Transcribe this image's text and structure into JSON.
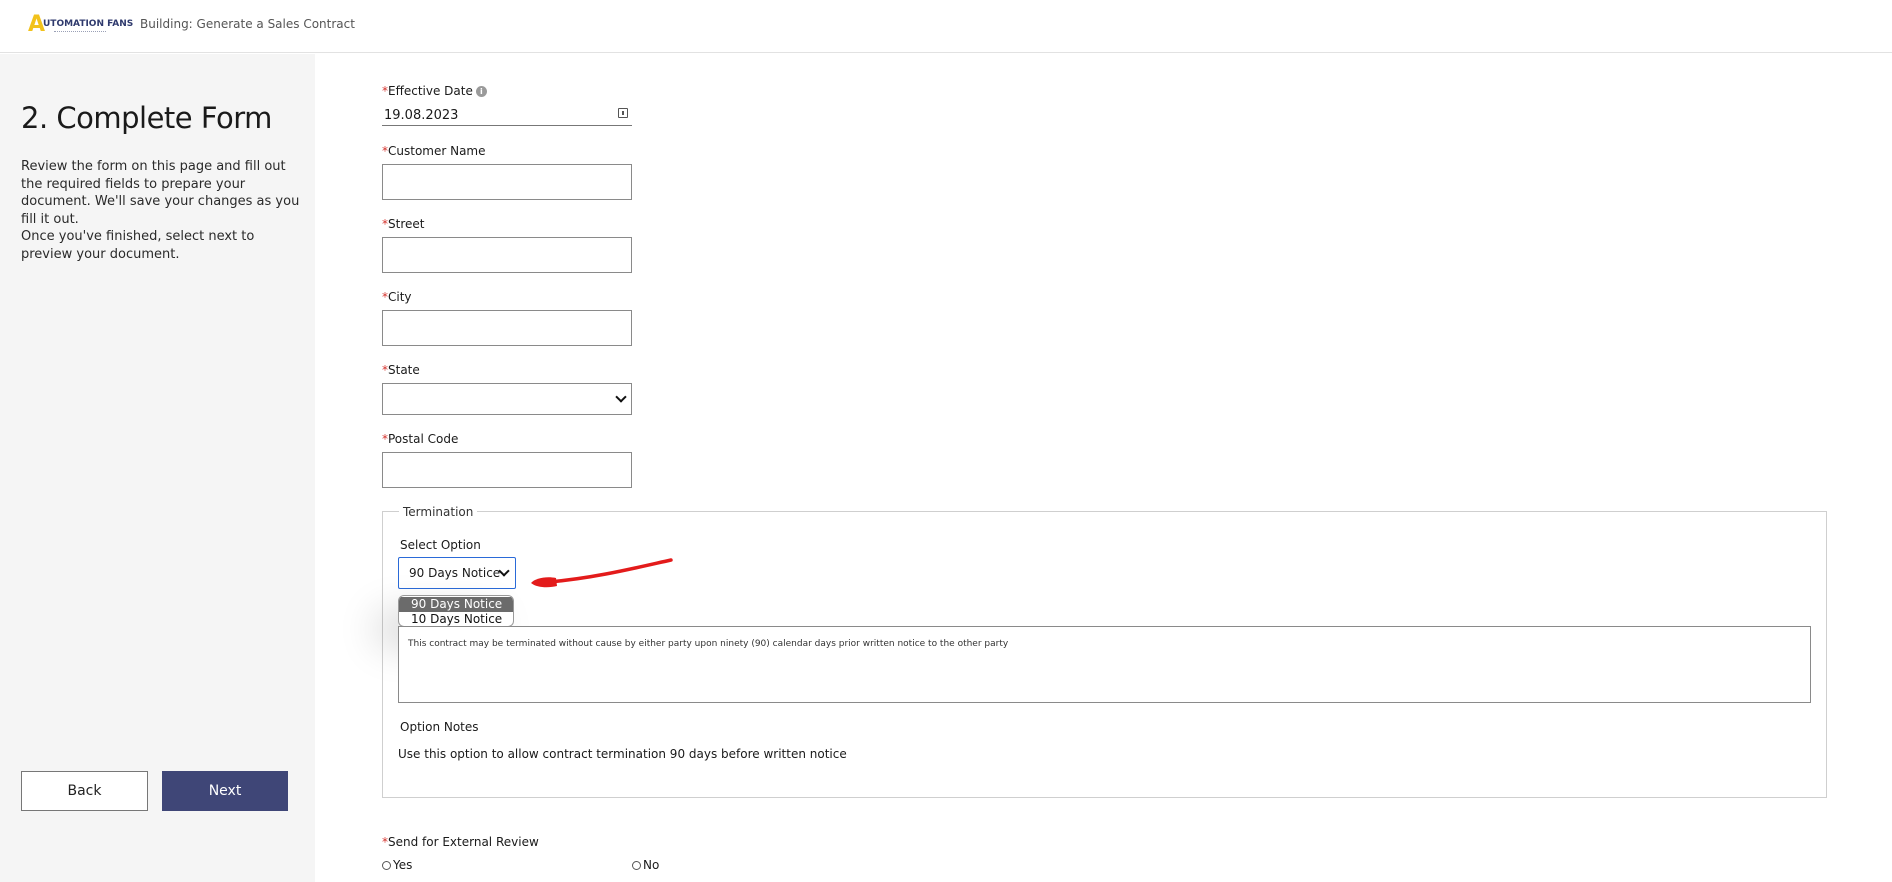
{
  "header": {
    "logo_letter": "A",
    "logo_text": "UTOMATION FANS",
    "title": "Building: Generate a Sales Contract"
  },
  "sidebar": {
    "title": "2. Complete Form",
    "description": "Review the form on this page and fill out the required fields to prepare your document. We'll save your changes as you fill it out.",
    "description2": "Once you've finished, select next to preview your document.",
    "back_label": "Back",
    "next_label": "Next"
  },
  "form": {
    "required_marker": "*",
    "effective_date": {
      "label": "Effective Date",
      "value": "19.08.2023",
      "info_icon": "info-icon"
    },
    "customer_name": {
      "label": "Customer Name",
      "value": ""
    },
    "street": {
      "label": "Street",
      "value": ""
    },
    "city": {
      "label": "City",
      "value": ""
    },
    "state": {
      "label": "State",
      "value": ""
    },
    "postal_code": {
      "label": "Postal Code",
      "value": ""
    },
    "termination": {
      "legend": "Termination",
      "select_label": "Select Option",
      "selected_value": "90 Days Notice",
      "options": [
        "90 Days Notice",
        "10 Days Notice"
      ],
      "description": "This contract may be terminated without cause by either party upon ninety (90) calendar days prior written notice to the other party",
      "notes_label": "Option Notes",
      "notes_text": "Use this option to allow contract termination 90 days before written notice"
    },
    "external_review": {
      "label": "Send for External Review",
      "yes_label": "Yes",
      "no_label": "No"
    }
  },
  "colors": {
    "accent": "#3f4677",
    "logo_yellow": "#f2c21b",
    "required": "#d4322c",
    "annotation": "#e31b1b",
    "focus_border": "#2a6ad8"
  }
}
